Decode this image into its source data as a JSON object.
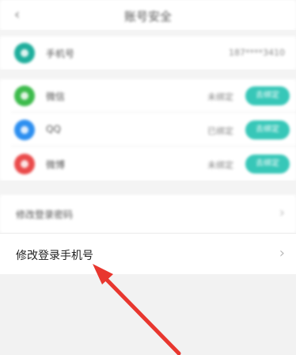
{
  "header": {
    "title": "账号安全",
    "back_icon": "chevron-left-icon"
  },
  "phone": {
    "label": "手机号",
    "value": "187****3410",
    "icon_color": "#1fae9c"
  },
  "bindings": [
    {
      "label": "微信",
      "status": "未绑定",
      "action": "去绑定",
      "icon_color": "#3dbb4c"
    },
    {
      "label": "QQ",
      "status": "已绑定",
      "action": "去绑定",
      "icon_color": "#2d8ff0"
    },
    {
      "label": "微博",
      "status": "未绑定",
      "action": "去绑定",
      "icon_color": "#ea4b4b"
    }
  ],
  "menu": {
    "item1": {
      "label": "修改登录密码"
    },
    "item2": {
      "label": "修改登录手机号"
    }
  },
  "colors": {
    "accent": "#37c7b8",
    "arrow": "#e8372f"
  }
}
